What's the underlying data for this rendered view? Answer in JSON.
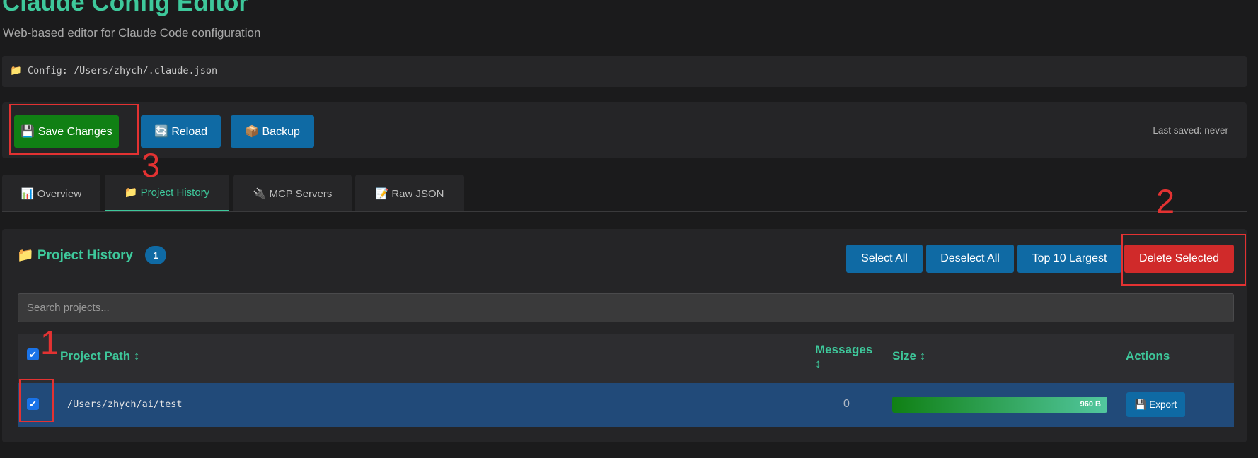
{
  "header": {
    "title": "Claude Config Editor",
    "subtitle": "Web-based editor for Claude Code configuration"
  },
  "config": {
    "icon": "folder-icon",
    "text": "📁 Config: /Users/zhych/.claude.json"
  },
  "toolbar": {
    "save_label": "💾 Save Changes",
    "reload_label": "🔄 Reload",
    "backup_label": "📦 Backup",
    "last_saved": "Last saved: never"
  },
  "tabs": [
    {
      "label": "📊 Overview"
    },
    {
      "label": "📁 Project History",
      "active": true
    },
    {
      "label": "🔌 MCP Servers"
    },
    {
      "label": "📝 Raw JSON"
    }
  ],
  "panel": {
    "title": "📁 Project History",
    "count": "1",
    "buttons": {
      "select_all": "Select All",
      "deselect_all": "Deselect All",
      "top10": "Top 10 Largest",
      "delete": "Delete Selected"
    }
  },
  "search": {
    "placeholder": "Search projects...",
    "value": ""
  },
  "table": {
    "columns": {
      "path": "Project Path ↕",
      "messages_line1": "Messages",
      "messages_line2": "↕",
      "size": "Size ↕",
      "actions": "Actions"
    },
    "header_checkbox_checked": true,
    "rows": [
      {
        "checked": true,
        "path": "/Users/zhych/ai/test",
        "messages": "0",
        "size": "960 B",
        "size_fraction": 1.0,
        "action": "💾 Export"
      }
    ]
  },
  "annotations": [
    {
      "number": "1",
      "color": "#e33232"
    },
    {
      "number": "2",
      "color": "#e33232"
    },
    {
      "number": "3",
      "color": "#e33232"
    }
  ],
  "colors": {
    "accent": "#3ec89b",
    "primary_button": "#0f6aa4",
    "save_button": "#108014",
    "danger_button": "#d02a2a",
    "selected_row": "#214a79",
    "background": "#1b1b1c",
    "annotation": "#e33232"
  }
}
